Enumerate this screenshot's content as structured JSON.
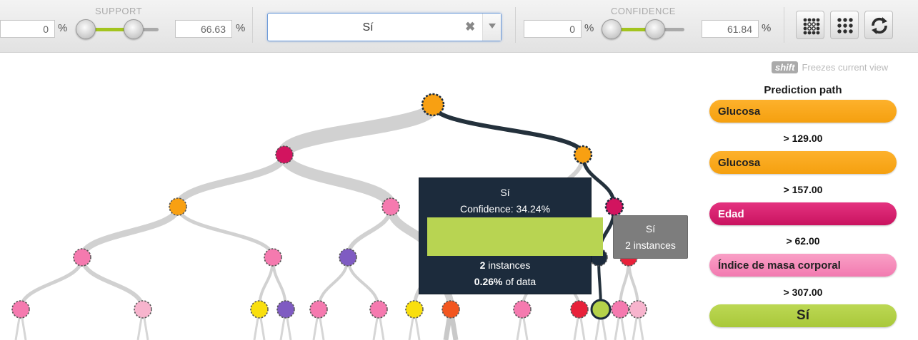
{
  "toolbar": {
    "support": {
      "title": "SUPPORT",
      "min_value": "0",
      "max_value": "66.63",
      "unit": "%",
      "low_fraction": 0.0,
      "high_fraction": 0.6663
    },
    "class_select": {
      "value": "Sí",
      "clear_glyph": "✖"
    },
    "confidence": {
      "title": "CONFIDENCE",
      "min_value": "0",
      "max_value": "61.84",
      "unit": "%",
      "low_fraction": 0.0,
      "high_fraction": 0.6184
    },
    "buttons": [
      {
        "name": "collapse-view-button",
        "icon": "grid-small-dots-icon"
      },
      {
        "name": "expand-view-button",
        "icon": "grid-large-dots-icon"
      },
      {
        "name": "reset-button",
        "icon": "refresh-icon"
      }
    ]
  },
  "hint": {
    "key": "shift",
    "text": "Freezes current view"
  },
  "prediction_path": {
    "title": "Prediction path",
    "steps": [
      {
        "field": "Glucosa",
        "color": "#f7a416",
        "condition": "> 129.00"
      },
      {
        "field": "Glucosa",
        "color": "#f7a416",
        "condition": "> 157.00"
      },
      {
        "field": "Edad",
        "color": "#d01a6a",
        "condition": "> 62.00"
      },
      {
        "field": "Índice de masa corporal",
        "color": "#f58bb8",
        "condition": "> 307.00"
      }
    ],
    "prediction": {
      "label": "Sí",
      "color": "#b3d048"
    }
  },
  "tooltip": {
    "class": "Sí",
    "confidence": "Confidence: 34.24%",
    "confidence_fraction": 0.3424,
    "instances_count": "2",
    "instances_label": " instances",
    "data_pct": "0.26%",
    "data_label": " of data"
  },
  "small_tooltip": {
    "class": "Sí",
    "instances": "2 instances"
  },
  "node_colors": {
    "orange": "#f8a012",
    "magenta": "#d2145f",
    "pink": "#f57aaf",
    "light-pink": "#f7b4cd",
    "purple": "#7f5bc2",
    "yellow": "#f9df0e",
    "orange-red": "#f25620",
    "red": "#e8213a",
    "green": "#b5d24a",
    "dark": "#1c2b3c"
  }
}
